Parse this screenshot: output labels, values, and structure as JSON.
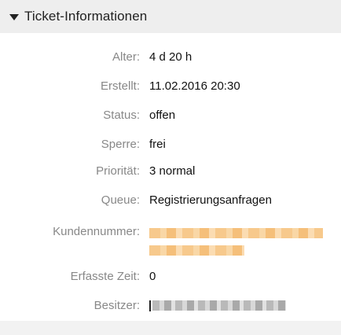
{
  "panel": {
    "title": "Ticket-Informationen",
    "toggle_icon": "triangle-down-icon"
  },
  "fields": [
    {
      "key": "age",
      "label": "Alter:",
      "value": "4 d 20 h"
    },
    {
      "key": "created",
      "label": "Erstellt:",
      "value": "11.02.2016 20:30"
    },
    {
      "key": "state",
      "label": "Status:",
      "value": "offen"
    },
    {
      "key": "lock",
      "label": "Sperre:",
      "value": "frei"
    },
    {
      "key": "priority",
      "label": "Priorität:",
      "value": "3 normal"
    },
    {
      "key": "queue",
      "label": "Queue:",
      "value": "Registrierungsanfragen"
    },
    {
      "key": "customer_id",
      "label": "Kundennummer:",
      "value": ""
    },
    {
      "key": "accounted_time",
      "label": "Erfasste Zeit:",
      "value": "0"
    },
    {
      "key": "owner",
      "label": "Besitzer:",
      "value": ""
    }
  ],
  "colors": {
    "header_bg": "#eeeeee",
    "label_text": "#888888",
    "value_text": "#111111",
    "redaction_orange": "#f7c98c",
    "redaction_gray": "#b9b9b9"
  }
}
